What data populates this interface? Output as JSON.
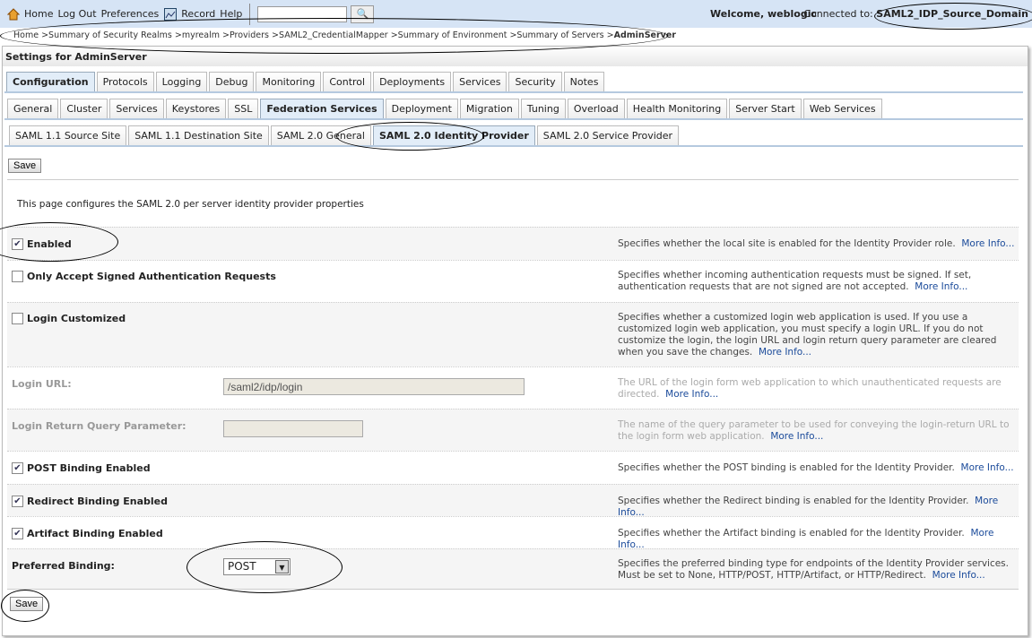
{
  "topbar": {
    "home": "Home",
    "logout": "Log Out",
    "preferences": "Preferences",
    "record": "Record",
    "help": "Help",
    "search_value": "",
    "welcome": "Welcome, weblogic",
    "connected_label": "Connected to:",
    "domain": "SAML2_IDP_Source_Domain"
  },
  "breadcrumb": {
    "path": "Home >Summary of Security Realms >myrealm >Providers >SAML2_CredentialMapper >Summary of Environment >Summary of Servers >",
    "current": "AdminServer"
  },
  "panel_title": "Settings for AdminServer",
  "tabs1": [
    "Configuration",
    "Protocols",
    "Logging",
    "Debug",
    "Monitoring",
    "Control",
    "Deployments",
    "Services",
    "Security",
    "Notes"
  ],
  "tabs2": [
    "General",
    "Cluster",
    "Services",
    "Keystores",
    "SSL",
    "Federation Services",
    "Deployment",
    "Migration",
    "Tuning",
    "Overload",
    "Health Monitoring",
    "Server Start",
    "Web Services"
  ],
  "tabs3": [
    "SAML 1.1 Source Site",
    "SAML 1.1 Destination Site",
    "SAML 2.0 General",
    "SAML 2.0 Identity Provider",
    "SAML 2.0 Service Provider"
  ],
  "save": "Save",
  "intro": "This page configures the SAML 2.0 per server identity provider properties",
  "more": "More Info...",
  "fields": {
    "enabled": {
      "label": "Enabled",
      "checked": true,
      "desc": "Specifies whether the local site is enabled for the Identity Provider role."
    },
    "signed": {
      "label": "Only Accept Signed Authentication Requests",
      "checked": false,
      "desc": "Specifies whether incoming authentication requests must be signed. If set, authentication requests that are not signed are not accepted."
    },
    "custom": {
      "label": "Login Customized",
      "checked": false,
      "desc": "Specifies whether a customized login web application is used. If you use a customized login web application, you must specify a login URL. If you do not customize the login, the login URL and login return query parameter are cleared when you save the changes."
    },
    "url": {
      "label": "Login URL:",
      "value": "/saml2/idp/login",
      "desc": "The URL of the login form web application to which unauthenticated requests are directed."
    },
    "ret": {
      "label": "Login Return Query Parameter:",
      "value": "",
      "desc": "The name of the query parameter to be used for conveying the login-return URL to the login form web application."
    },
    "post": {
      "label": "POST Binding Enabled",
      "checked": true,
      "desc": "Specifies whether the POST binding is enabled for the Identity Provider."
    },
    "redirect": {
      "label": "Redirect Binding Enabled",
      "checked": true,
      "desc": "Specifies whether the Redirect binding is enabled for the Identity Provider."
    },
    "artifact": {
      "label": "Artifact Binding Enabled",
      "checked": true,
      "desc": "Specifies whether the Artifact binding is enabled for the Identity Provider."
    },
    "pref": {
      "label": "Preferred Binding:",
      "value": "POST",
      "desc": "Specifies the preferred binding type for endpoints of the Identity Provider services. Must be set to None, HTTP/POST, HTTP/Artifact, or HTTP/Redirect."
    }
  }
}
